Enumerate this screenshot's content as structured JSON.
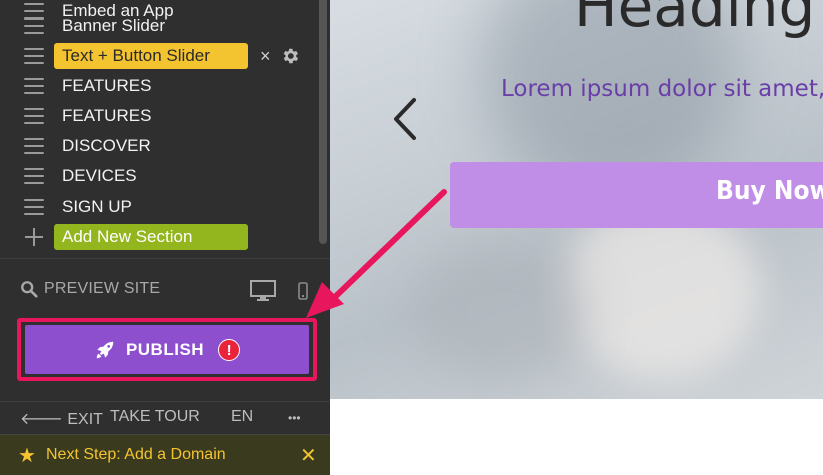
{
  "sidebar": {
    "sections": [
      {
        "label": "Embed an App",
        "state": "normal"
      },
      {
        "label": "Banner Slider",
        "state": "normal"
      },
      {
        "label": "Text + Button Slider",
        "state": "active"
      },
      {
        "label": "FEATURES",
        "state": "normal"
      },
      {
        "label": "FEATURES",
        "state": "normal"
      },
      {
        "label": "DISCOVER",
        "state": "normal"
      },
      {
        "label": "DEVICES",
        "state": "normal"
      },
      {
        "label": "SIGN UP",
        "state": "normal"
      }
    ],
    "add_section_label": "Add New Section",
    "active_row_close": "×",
    "preview_label": "PREVIEW SITE",
    "publish_label": "PUBLISH",
    "publish_alert": "!",
    "bottom": {
      "exit_label": "EXIT",
      "exit_arrow": "🡐",
      "tour_label": "TAKE TOUR",
      "language_label": "EN",
      "more_label": "•••"
    },
    "next_step": {
      "star": "★",
      "text": "Next Step: Add a Domain",
      "close": "✕"
    }
  },
  "preview": {
    "heading": "Heading",
    "subtitle": "Lorem ipsum dolor sit amet, con",
    "button_label": "Buy Now"
  },
  "colors": {
    "sidebar_bg": "#2f2f2f",
    "active_section": "#f4c430",
    "add_section": "#93b51d",
    "publish": "#8e4fcf",
    "highlight": "#e8175d",
    "buy_button": "#c08ee6",
    "subtitle": "#6a3ea8"
  },
  "icons": {
    "drag_handle": "drag-handle-icon",
    "plus": "plus-icon",
    "gear": "gear-icon",
    "search": "search-icon",
    "desktop": "desktop-icon",
    "mobile": "mobile-icon",
    "rocket": "rocket-icon",
    "star": "star-icon"
  }
}
